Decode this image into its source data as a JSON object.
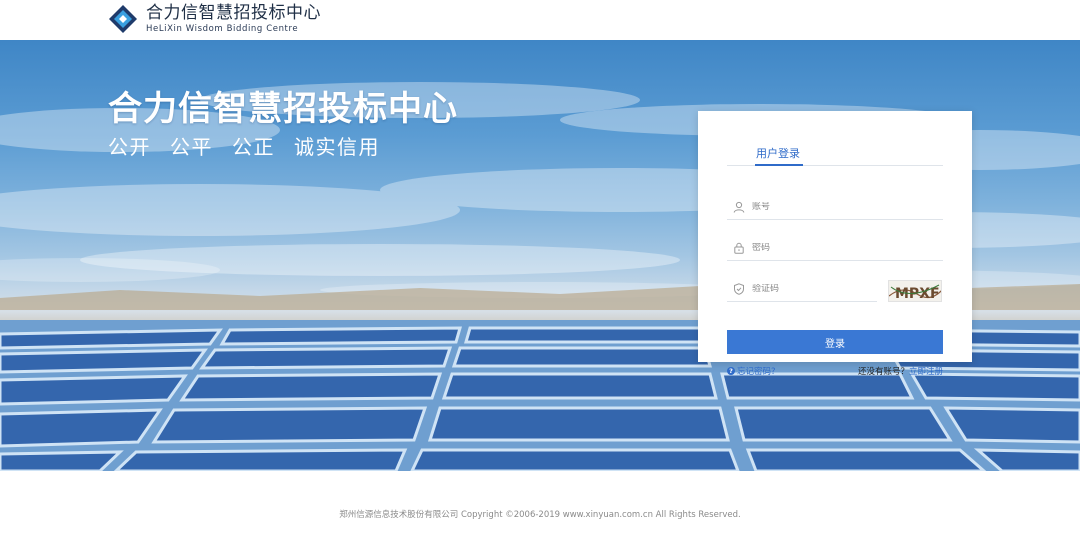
{
  "header": {
    "logo_title": "合力信智慧招投标中心",
    "logo_subtitle": "HeLiXin Wisdom Bidding Centre",
    "logo_icon": "diamond-logo-icon"
  },
  "hero": {
    "title": "合力信智慧招投标中心",
    "slogans": [
      "公开",
      "公平",
      "公正",
      "诚实信用"
    ]
  },
  "login": {
    "tab_label": "用户登录",
    "account_placeholder": "账号",
    "password_placeholder": "密码",
    "captcha_placeholder": "验证码",
    "captcha_text": "MPXF",
    "submit_label": "登录",
    "forgot_label": "忘记密码?",
    "no_account_label": "还没有账号？",
    "register_label": "立即注册",
    "icons": [
      "user-icon",
      "lock-icon",
      "shield-icon",
      "question-icon"
    ]
  },
  "footer": {
    "copyright": "郑州信源信息技术股份有限公司 Copyright ©2006-2019 www.xinyuan.com.cn All Rights Reserved."
  },
  "colors": {
    "accent": "#2f6bc9",
    "button": "#3a78d4",
    "logo_dark": "#1f3b6b",
    "logo_light": "#3aa0e0"
  }
}
